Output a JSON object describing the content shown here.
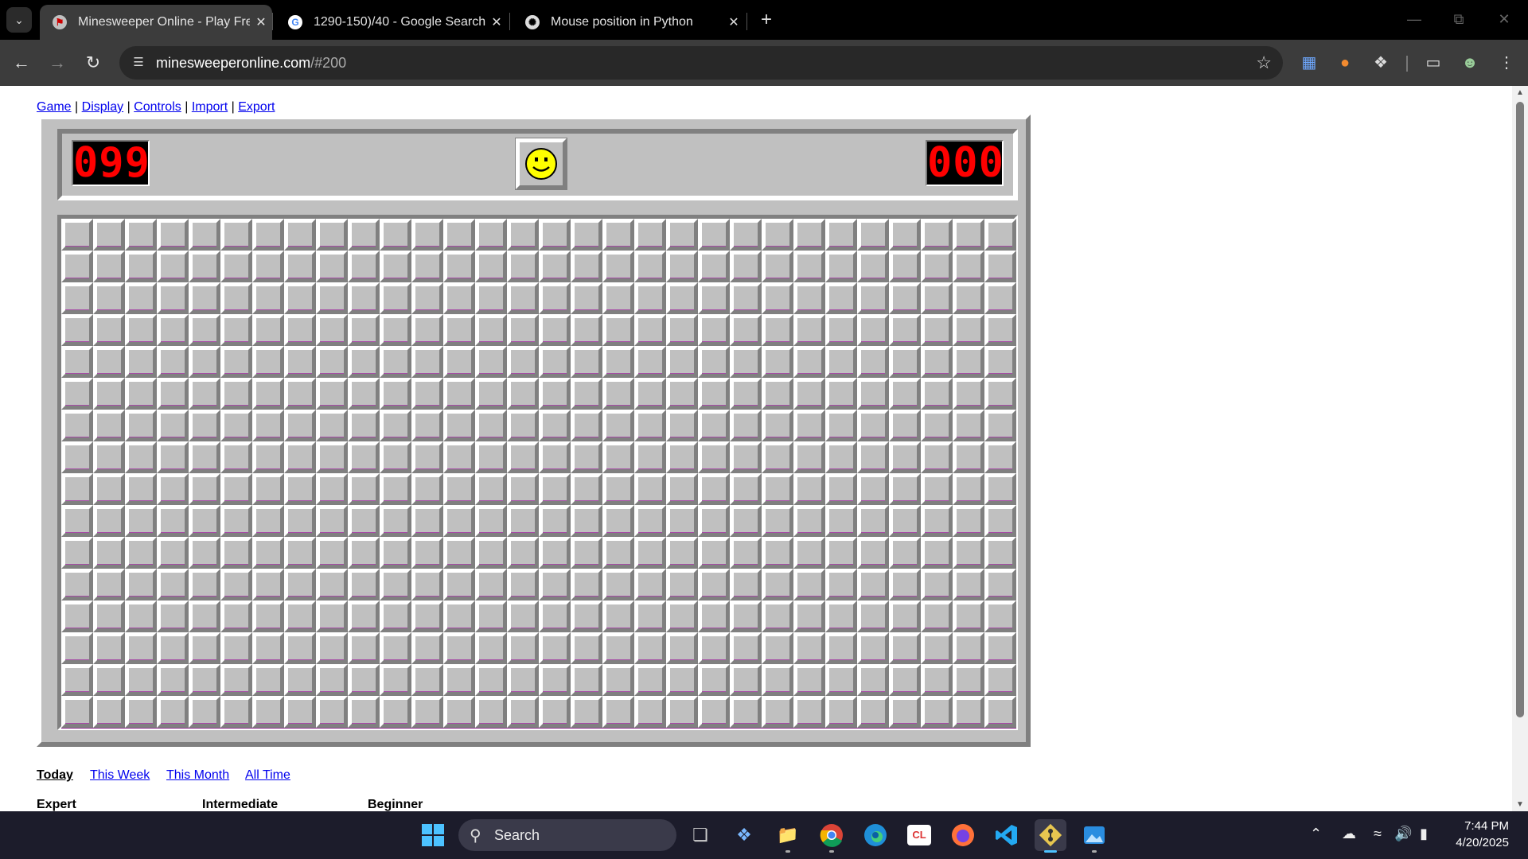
{
  "browser": {
    "tabs": [
      {
        "title": "Minesweeper Online - Play Free",
        "favicon": "minesweeper-favicon",
        "active": true
      },
      {
        "title": "1290-150)/40 - Google Search",
        "favicon": "google-favicon",
        "active": false
      },
      {
        "title": "Mouse position in Python",
        "favicon": "chatgpt-favicon",
        "active": false
      }
    ],
    "url": {
      "host": "minesweeperonline.com",
      "path": "/#200"
    }
  },
  "page": {
    "menu": {
      "game": "Game",
      "display": "Display",
      "controls": "Controls",
      "import": "Import",
      "export": "Export",
      "separator": "|"
    },
    "game": {
      "mines_counter": "099",
      "timer": "000",
      "face": "smiley-face-icon",
      "rows": 16,
      "cols": 30,
      "colors": {
        "face_bg": "#c0c0c0",
        "lcd_digits": "#ff0000",
        "grid_line": "#8a2f8a"
      }
    },
    "leaderboard": {
      "periods": [
        "Today",
        "This Week",
        "This Month",
        "All Time"
      ],
      "active_period": "Today",
      "levels": [
        "Expert",
        "Intermediate",
        "Beginner"
      ]
    }
  },
  "taskbar": {
    "search_label": "Search",
    "apps": [
      "windows-start-icon",
      "task-view-icon",
      "copilot-icon",
      "file-explorer-icon",
      "chrome-icon",
      "edge-icon",
      "app-cl-icon",
      "firefox-icon",
      "vscode-icon",
      "git-app-icon",
      "pictures-app-icon"
    ],
    "time": "7:44 PM",
    "date": "4/20/2025"
  }
}
